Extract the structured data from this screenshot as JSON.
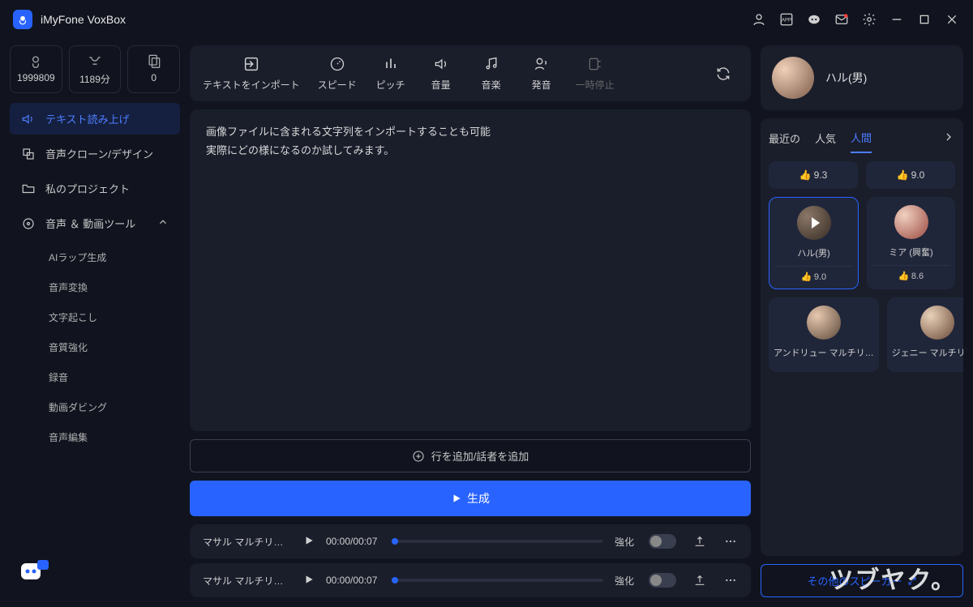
{
  "app": {
    "title": "iMyFone VoxBox"
  },
  "stats": [
    {
      "value": "1999809"
    },
    {
      "value": "1189分"
    },
    {
      "value": "0"
    }
  ],
  "nav": {
    "tts": "テキスト読み上げ",
    "voice_clone": "音声クローン/デザイン",
    "my_projects": "私のプロジェクト",
    "av_tools": "音声 ＆ 動画ツール",
    "sub": {
      "ai_rap": "AIラップ生成",
      "voice_change": "音声変換",
      "transcribe": "文字起こし",
      "enhance": "音質強化",
      "record": "録音",
      "dubbing": "動画ダビング",
      "audio_edit": "音声編集"
    }
  },
  "toolbar": {
    "import": "テキストをインポート",
    "speed": "スピード",
    "pitch": "ピッチ",
    "volume": "音量",
    "music": "音楽",
    "pronounce": "発音",
    "pause": "一時停止"
  },
  "editor": {
    "line1": "画像ファイルに含まれる文字列をインポートすることも可能",
    "line2": "実際にどの様になるのか試してみます。"
  },
  "buttons": {
    "add_row": "行を追加/話者を追加",
    "generate": "生成",
    "other_speakers": "その他のスピーカー"
  },
  "tracks": [
    {
      "name": "マサル マルチリンガ…",
      "time": "00:00/00:07",
      "enhance": "強化"
    },
    {
      "name": "マサル マルチリンガ…",
      "time": "00:00/00:07",
      "enhance": "強化"
    }
  ],
  "speaker": {
    "current": "ハル(男)",
    "tabs": {
      "recent": "最近の",
      "popular": "人気",
      "human": "人間"
    },
    "top_ratings": [
      "9.3",
      "9.0"
    ],
    "cards": [
      {
        "name": "ハル(男)",
        "rating": "9.0",
        "selected": true,
        "play": true
      },
      {
        "name": "ミア (興奮)",
        "rating": "8.6"
      },
      {
        "name": "アンドリュー マルチリ…"
      },
      {
        "name": "ジェニー マルチリン…"
      }
    ]
  },
  "watermark": "ツブヤク。"
}
